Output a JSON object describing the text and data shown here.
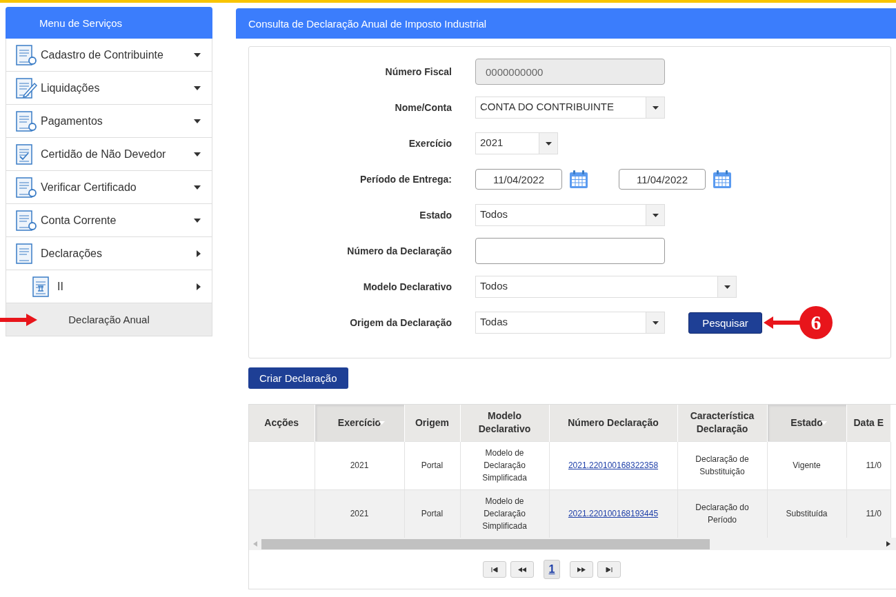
{
  "sidebar": {
    "title": "Menu de Serviços",
    "items": [
      {
        "label": "Cadastro de Contribuinte",
        "kind": "search",
        "selected": false
      },
      {
        "label": "Liquidações",
        "kind": "pencil",
        "selected": false
      },
      {
        "label": "Pagamentos",
        "kind": "search",
        "selected": false
      },
      {
        "label": "Certidão de Não Devedor",
        "kind": "check",
        "selected": false
      },
      {
        "label": "Verificar Certificado",
        "kind": "search",
        "selected": false
      },
      {
        "label": "Conta Corrente",
        "kind": "search",
        "selected": false
      },
      {
        "label": "Declarações",
        "kind": "plain",
        "selected": false,
        "children": [
          {
            "label": "II",
            "kind": "numeral",
            "selected": false,
            "children": [
              {
                "label": "Declaração Anual",
                "selected": true
              }
            ]
          }
        ]
      }
    ]
  },
  "panel": {
    "title": "Consulta de Declaração Anual de Imposto Industrial",
    "form": [
      {
        "kind": "readonly",
        "label": "Número Fiscal",
        "value": "0000000000"
      },
      {
        "kind": "select",
        "label": "Nome/Conta",
        "value": "CONTA DO CONTRIBUINTE"
      },
      {
        "kind": "select",
        "label": "Exercício",
        "value": "2021"
      },
      {
        "kind": "date-range",
        "label": "Período de Entrega:",
        "from": "11/04/2022",
        "to": "11/04/2022"
      },
      {
        "kind": "select",
        "label": "Estado",
        "value": "Todos"
      },
      {
        "kind": "text",
        "label": "Número da Declaração"
      },
      {
        "kind": "select",
        "label": "Modelo Declarativo",
        "value": "Todos"
      },
      {
        "kind": "select",
        "label": "Origem da Declaração",
        "value": "Todas"
      }
    ],
    "search_button": "Pesquisar",
    "callout": {
      "number": "6"
    },
    "create_button": "Criar Declaração",
    "table": {
      "columns": [
        {
          "label": "Acções",
          "sortable": false
        },
        {
          "label": "Exercício",
          "sortable": true
        },
        {
          "label": "Origem",
          "sortable": false
        },
        {
          "label": "Modelo Declarativo",
          "sortable": false
        },
        {
          "label": "Número Declaração",
          "sortable": false
        },
        {
          "label": "Característica Declaração",
          "sortable": false
        },
        {
          "label": "Estado",
          "sortable": true
        },
        {
          "label": "Data E",
          "sortable": false
        }
      ],
      "rows": [
        {
          "cells": [
            "",
            "2021",
            "Portal",
            "Modelo de Declaração Simplificada",
            "2021.220100168322358",
            "Declaração de Substituição",
            "Vigente",
            "11/0"
          ]
        },
        {
          "cells": [
            "",
            "2021",
            "Portal",
            "Modelo de Declaração Simplificada",
            "2021.220100168193445",
            "Declaração do Período",
            "Substituída",
            "11/0"
          ]
        }
      ]
    },
    "pager": {
      "pages": [
        {
          "label": "1",
          "selected": true
        }
      ]
    }
  }
}
